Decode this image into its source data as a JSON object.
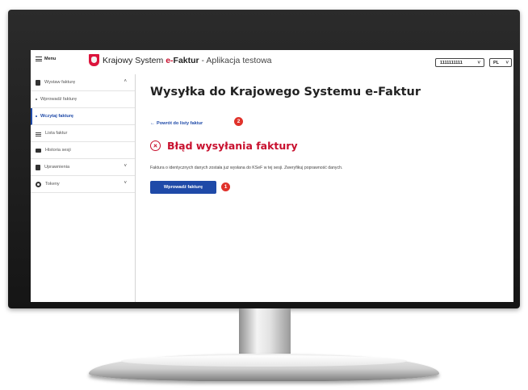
{
  "header": {
    "menu_label": "Menu",
    "brand_pre": "Krajowy System ",
    "brand_accent": "e-",
    "brand_strong": "Faktur",
    "brand_suffix": " - Aplikacja testowa",
    "nip_value": "1111111111",
    "lang_value": "PL"
  },
  "sidebar": {
    "items": [
      {
        "label": "Wystaw fakturę",
        "icon": "document-icon",
        "expand": "˄"
      },
      {
        "label": "Wprowadź fakturę",
        "sub": true
      },
      {
        "label": "Wczytaj fakturę",
        "sub": true,
        "active": true
      },
      {
        "label": "Lista faktur",
        "icon": "list-icon"
      },
      {
        "label": "Historia sesji",
        "icon": "mail-icon"
      },
      {
        "label": "Uprawnienia",
        "icon": "document-icon",
        "expand": "˅"
      },
      {
        "label": "Tokeny",
        "icon": "token-icon",
        "expand": "˅"
      }
    ]
  },
  "main": {
    "title": "Wysyłka do Krajowego Systemu e-Faktur",
    "back_link": "Powrót do listy faktur",
    "back_badge": "2",
    "error_title": "Błąd wysyłania faktury",
    "error_message": "Faktura o identycznych danych została już wysłana do KSeF w tej sesji. Zweryfikuj poprawność danych.",
    "primary_button": "Wprowadź fakturę",
    "button_badge": "1"
  },
  "colors": {
    "accent_blue": "#1f4aa8",
    "error_red": "#c8102e",
    "badge_red": "#e0322b"
  }
}
